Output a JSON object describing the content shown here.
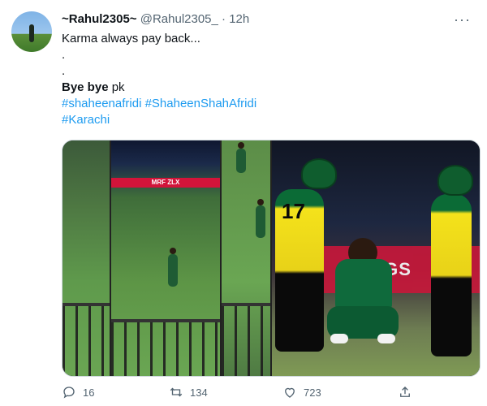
{
  "user": {
    "display_name": "~Rahul2305~",
    "handle": "@Rahul2305_",
    "separator": "·",
    "time": "12h"
  },
  "more_icon": "more-icon",
  "tweet": {
    "lines": [
      "Karma always pay back...",
      ".",
      "."
    ],
    "bye_bold": "Bye bye",
    "bye_rest": "pk",
    "hashtags_line1": "#shaheenafridi #ShaheenShahAfridi",
    "hashtags_line2": "#Karachi"
  },
  "media": {
    "adboard_text": "MRF ZLX",
    "adboard_text_large": "INGS",
    "jersey_number": "17"
  },
  "actions": {
    "reply_count": "16",
    "retweet_count": "134",
    "like_count": "723"
  },
  "colors": {
    "link": "#1d9bf0",
    "muted": "#536471"
  }
}
